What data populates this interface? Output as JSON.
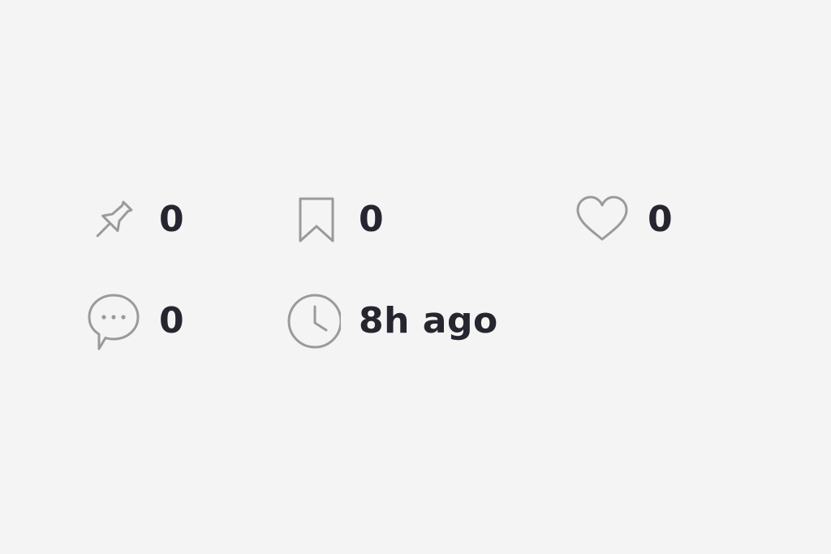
{
  "stats": {
    "pins": {
      "icon": "pin-icon",
      "value": "0"
    },
    "bookmarks": {
      "icon": "bookmark-icon",
      "value": "0"
    },
    "likes": {
      "icon": "heart-icon",
      "value": "0"
    },
    "comments": {
      "icon": "comment-icon",
      "value": "0"
    },
    "posted": {
      "icon": "clock-icon",
      "value": "8h ago"
    }
  },
  "colors": {
    "background": "#f4f4f4",
    "icon": "#9a9a9a",
    "text": "#262630"
  }
}
